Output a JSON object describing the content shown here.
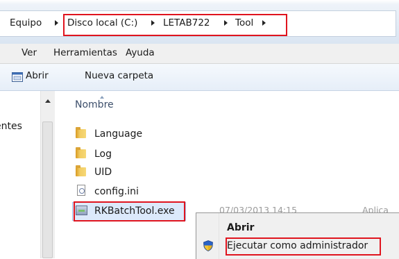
{
  "address_bar": {
    "segments": [
      "Equipo",
      "Disco local (C:)",
      "LETAB722",
      "Tool"
    ]
  },
  "menu_bar": {
    "items": [
      "Ver",
      "Herramientas",
      "Ayuda"
    ]
  },
  "toolbar": {
    "open_label": "Abrir",
    "new_folder_label": "Nueva carpeta"
  },
  "nav_pane": {
    "partial_label": "entes"
  },
  "file_list": {
    "column_name": "Nombre",
    "items": [
      {
        "name": "Language",
        "type": "folder"
      },
      {
        "name": "Log",
        "type": "folder"
      },
      {
        "name": "UID",
        "type": "folder"
      },
      {
        "name": "config.ini",
        "type": "ini-file"
      },
      {
        "name": "RKBatchTool.exe",
        "type": "exe-file",
        "date": "07/03/2013 14:15",
        "kind": "Aplica"
      }
    ]
  },
  "context_menu": {
    "items": [
      {
        "label": "Abrir",
        "bold": true
      },
      {
        "label": "Ejecutar como administrador",
        "icon": "uac-shield-icon"
      }
    ]
  },
  "highlight_color": "#e0141e"
}
